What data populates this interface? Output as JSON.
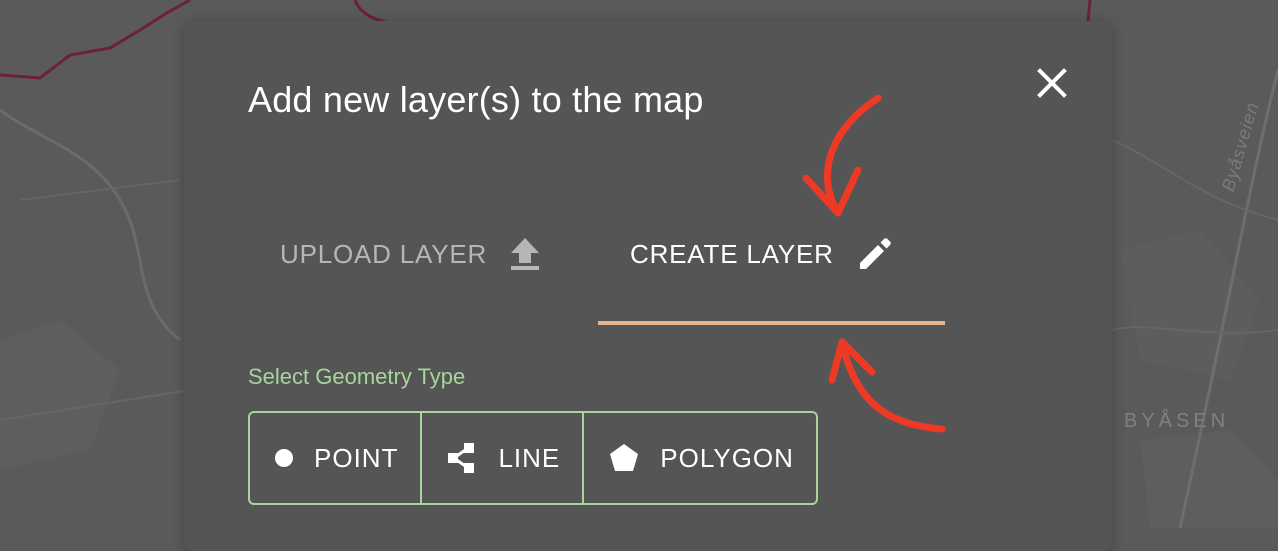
{
  "map": {
    "street_label": "Byåsveien",
    "area_label": "BYÅSEN",
    "route_color": "#6d1f3e",
    "background_color": "#5a5a5a"
  },
  "dialog": {
    "title": "Add new layer(s) to the map",
    "close_icon": "close-icon",
    "tabs": [
      {
        "label": "UPLOAD LAYER",
        "icon": "upload-icon",
        "active": false
      },
      {
        "label": "CREATE LAYER",
        "icon": "pencil-icon",
        "active": true
      }
    ],
    "active_tab_color": "#e8b48c",
    "geometry": {
      "label": "Select Geometry Type",
      "accent_color": "#a8d59b",
      "options": [
        {
          "label": "POINT",
          "icon": "point-icon"
        },
        {
          "label": "LINE",
          "icon": "line-icon"
        },
        {
          "label": "POLYGON",
          "icon": "polygon-icon"
        }
      ]
    }
  },
  "annotations": {
    "arrow_color": "#ee3a24",
    "arrows": [
      "arrow-down-icon",
      "arrow-up-icon"
    ]
  }
}
